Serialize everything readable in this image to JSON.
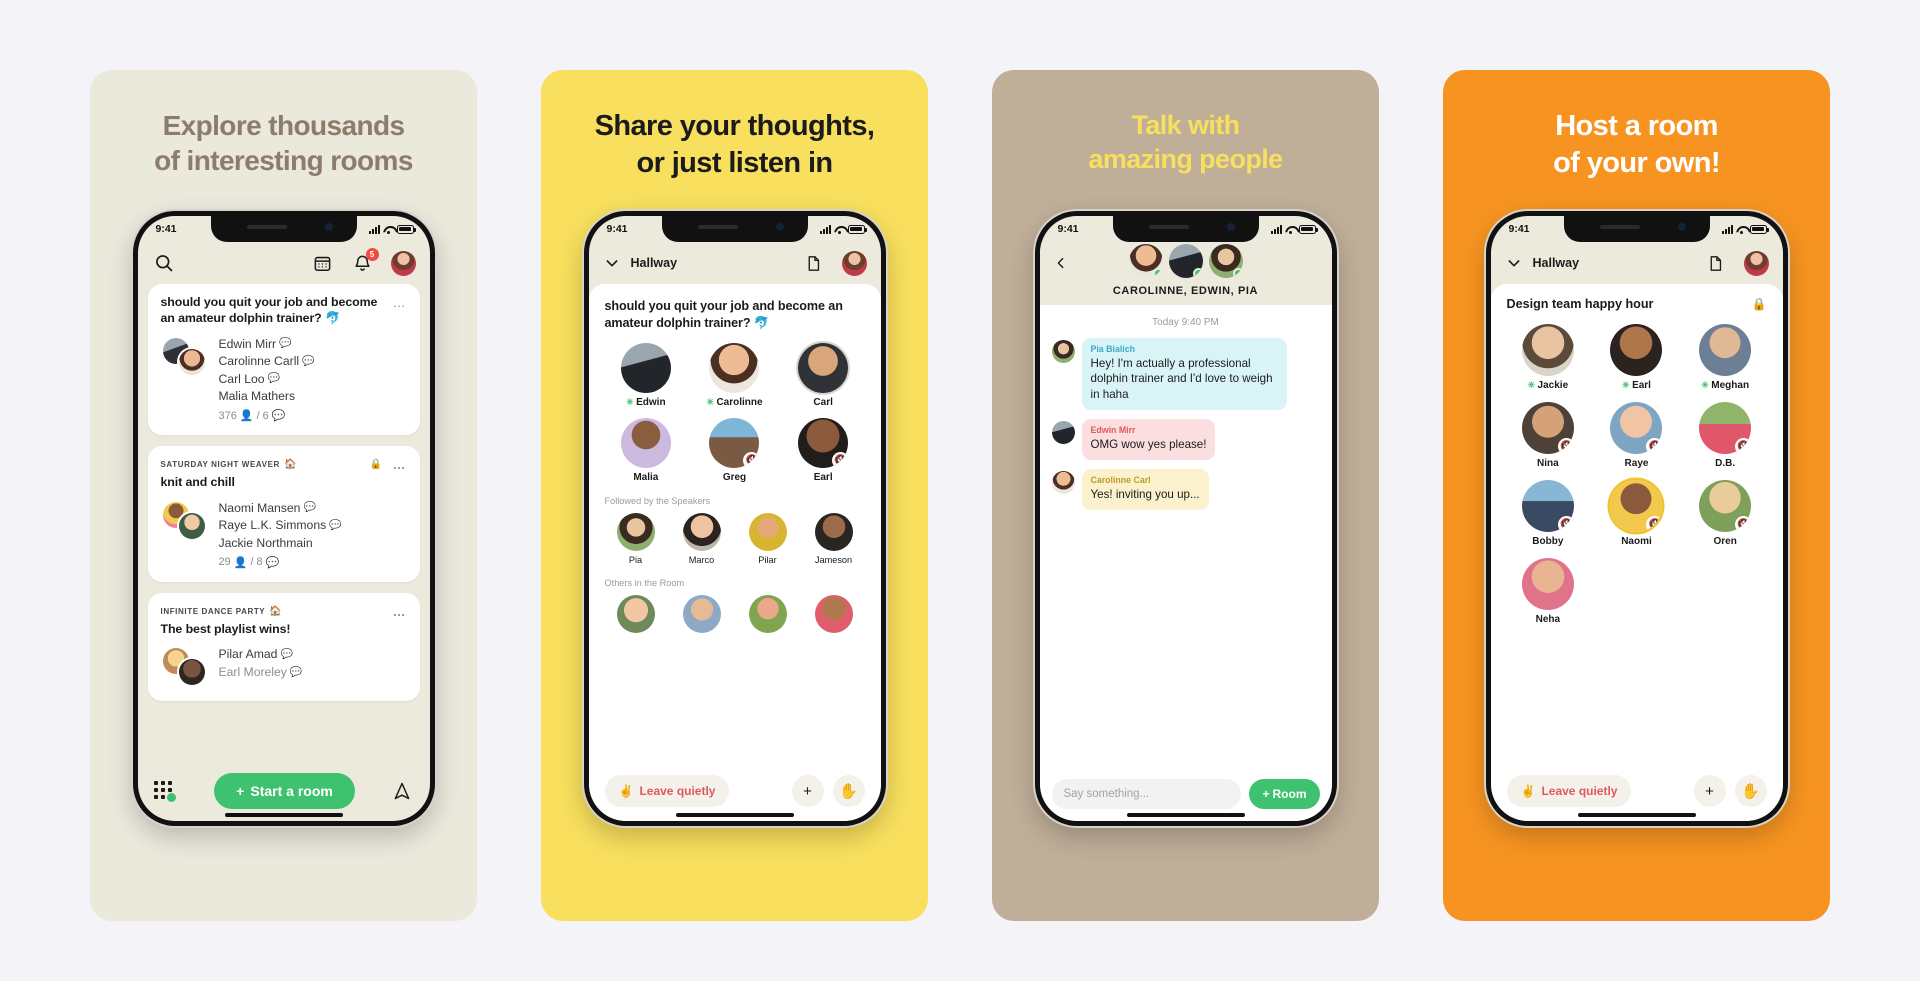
{
  "gallery": {
    "background": "#f4f4f8"
  },
  "panels": [
    {
      "id": "explore",
      "bg": "#ebe8dc",
      "title_color": "#8b7d6b",
      "title_line1": "Explore thousands",
      "title_line2": "of interesting rooms",
      "screen": {
        "status_time": "9:41",
        "nav": {
          "search_icon": "search-icon",
          "calendar_icon": "calendar-icon",
          "bell_icon": "bell-icon",
          "bell_badge": "5",
          "avatar": "user-avatar"
        },
        "cards": [
          {
            "club": "",
            "title": "should you quit your job and become an amateur dolphin trainer? 🐬",
            "speakers": [
              "Edwin Mirr",
              "Carolinne Carll",
              "Carl Loo",
              "Malia Mathers"
            ],
            "speakers_with_chat": [
              true,
              true,
              true,
              false
            ],
            "listeners": "376",
            "speaking": "6",
            "locked": false,
            "more": "…"
          },
          {
            "club": "SATURDAY NIGHT WEAVER",
            "title": "knit and chill",
            "speakers": [
              "Naomi Mansen",
              "Raye L.K. Simmons",
              "Jackie Northmain"
            ],
            "speakers_with_chat": [
              true,
              true,
              false
            ],
            "listeners": "29",
            "speaking": "8",
            "locked": true,
            "more": "…"
          },
          {
            "club": "INFINITE DANCE PARTY",
            "title": "The best playlist wins!",
            "speakers": [
              "Pilar Amad",
              "Earl Moreley"
            ],
            "speakers_with_chat": [
              true,
              true
            ],
            "listeners": "",
            "speaking": "",
            "locked": false,
            "more": "…"
          }
        ],
        "bottom": {
          "grid_icon": "app-grid-icon",
          "start_room_label": "Start a room",
          "start_room_plus": "+",
          "start_room_color": "#3fc26f",
          "invite_icon": "paper-plane-icon"
        }
      }
    },
    {
      "id": "share",
      "bg": "#f8df5d",
      "title_color": "#1b1b1b",
      "title_line1": "Share your thoughts,",
      "title_line2": "or just listen in",
      "screen": {
        "status_time": "9:41",
        "nav": {
          "chevron_icon": "chevron-down-icon",
          "hallway_label": "Hallway",
          "note_icon": "note-icon",
          "avatar": "user-avatar"
        },
        "room_title": "should you quit your job and become an amateur dolphin trainer? 🐬",
        "speakers": [
          {
            "name": "Edwin",
            "badge": "green-star",
            "muted": false,
            "ring": false
          },
          {
            "name": "Carolinne",
            "badge": "green-star",
            "muted": false,
            "ring": false
          },
          {
            "name": "Carl",
            "badge": "",
            "muted": false,
            "ring": true
          },
          {
            "name": "Malia",
            "badge": "",
            "muted": false,
            "ring": false
          },
          {
            "name": "Greg",
            "badge": "",
            "muted": true,
            "ring": false
          },
          {
            "name": "Earl",
            "badge": "",
            "muted": true,
            "ring": false
          }
        ],
        "followed_label": "Followed by the Speakers",
        "followed": [
          "Pia",
          "Marco",
          "Pilar",
          "Jameson"
        ],
        "others_label": "Others in the Room",
        "bottom": {
          "leave_label": "Leave quietly",
          "leave_emoji": "✌️",
          "leave_color": "#e0585f",
          "plus_icon": "plus-icon",
          "hand_icon": "raise-hand-icon"
        }
      }
    },
    {
      "id": "talk",
      "bg": "#bfae98",
      "title_color": "#f8df5d",
      "title_line1": "Talk with",
      "title_line2": "amazing people",
      "screen": {
        "status_time": "9:41",
        "back_icon": "back-chevron-icon",
        "participants_title": "CAROLINNE, EDWIN, PIA",
        "participants": [
          "Carolinne",
          "Edwin",
          "Pia"
        ],
        "timestamp": "Today 9:40 PM",
        "messages": [
          {
            "who": "Pia Bialich",
            "who_color": "#3aa8c7",
            "bubble_color": "#d9f4f7",
            "text": "Hey! I'm actually a professional dolphin trainer and I'd love to weigh in haha"
          },
          {
            "who": "Edwin Mirr",
            "who_color": "#e0585f",
            "bubble_color": "#fbdee0",
            "text": "OMG wow yes please!"
          },
          {
            "who": "Carolinne Carl",
            "who_color": "#c09a22",
            "bubble_color": "#fbf1cd",
            "text": "Yes! inviting you up..."
          }
        ],
        "input_placeholder": "Say something...",
        "room_button_label": "Room",
        "room_button_plus": "+",
        "room_button_color": "#3fc26f"
      }
    },
    {
      "id": "host",
      "bg": "#f79421",
      "title_color": "#ffffff",
      "title_line1": "Host a room",
      "title_line2": "of your own!",
      "screen": {
        "status_time": "9:41",
        "nav": {
          "chevron_icon": "chevron-down-icon",
          "hallway_label": "Hallway",
          "note_icon": "note-icon",
          "avatar": "user-avatar"
        },
        "room_title": "Design team happy hour",
        "lock_icon": "lock-icon",
        "people": [
          {
            "name": "Jackie",
            "badge": "green-star",
            "muted": false,
            "highlight": false
          },
          {
            "name": "Earl",
            "badge": "green-star",
            "muted": false,
            "highlight": false
          },
          {
            "name": "Meghan",
            "badge": "green-star",
            "muted": false,
            "highlight": false
          },
          {
            "name": "Nina",
            "badge": "",
            "muted": true,
            "highlight": false
          },
          {
            "name": "Raye",
            "badge": "",
            "muted": true,
            "highlight": false
          },
          {
            "name": "D.B.",
            "badge": "",
            "muted": true,
            "highlight": false
          },
          {
            "name": "Bobby",
            "badge": "",
            "muted": true,
            "highlight": false
          },
          {
            "name": "Naomi",
            "badge": "",
            "muted": true,
            "highlight": true
          },
          {
            "name": "Oren",
            "badge": "",
            "muted": true,
            "highlight": false
          },
          {
            "name": "Neha",
            "badge": "",
            "muted": false,
            "highlight": false
          }
        ],
        "bottom": {
          "leave_label": "Leave quietly",
          "leave_emoji": "✌️",
          "plus_icon": "plus-icon",
          "hand_icon": "raise-hand-icon"
        }
      }
    }
  ]
}
